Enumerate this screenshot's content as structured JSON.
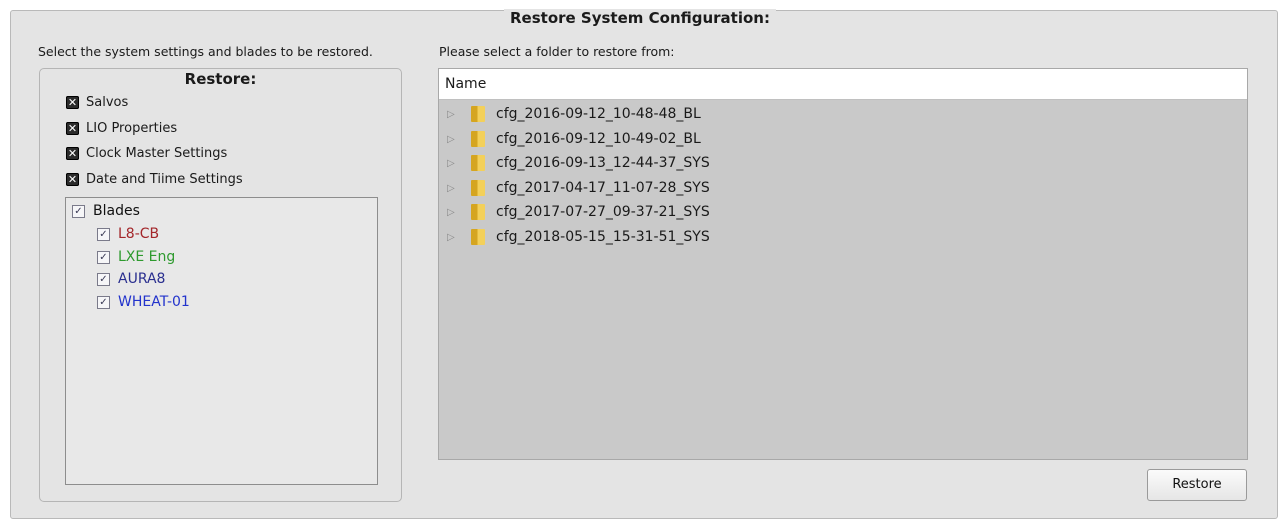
{
  "dialog": {
    "title": "Restore System Configuration:",
    "left_instruction": "Select the system settings and blades to be restored.",
    "right_instruction": "Please select a folder to restore from:"
  },
  "restore_panel": {
    "title": "Restore:",
    "options": [
      {
        "label": "Salvos",
        "checked": true
      },
      {
        "label": "LIO Properties",
        "checked": true
      },
      {
        "label": "Clock Master Settings",
        "checked": true
      },
      {
        "label": "Date and Tiime Settings",
        "checked": true
      }
    ],
    "blades": {
      "label": "Blades",
      "checked": true,
      "items": [
        {
          "label": "L8-CB",
          "checked": true,
          "color": "#a3262a"
        },
        {
          "label": "LXE Eng",
          "checked": true,
          "color": "#2e9a2e"
        },
        {
          "label": "AURA8",
          "checked": true,
          "color": "#2a2f8f"
        },
        {
          "label": "WHEAT-01",
          "checked": true,
          "color": "#2233cc"
        }
      ]
    }
  },
  "folder_list": {
    "column_header": "Name",
    "folders": [
      "cfg_2016-09-12_10-48-48_BL",
      "cfg_2016-09-12_10-49-02_BL",
      "cfg_2016-09-13_12-44-37_SYS",
      "cfg_2017-04-17_11-07-28_SYS",
      "cfg_2017-07-27_09-37-21_SYS",
      "cfg_2018-05-15_15-31-51_SYS"
    ]
  },
  "actions": {
    "restore_label": "Restore"
  },
  "icons": {
    "checked_x": "x-checkbox-icon",
    "checkmark": "check-icon",
    "folder": "folder-icon",
    "expander": "expand-triangle-icon"
  }
}
